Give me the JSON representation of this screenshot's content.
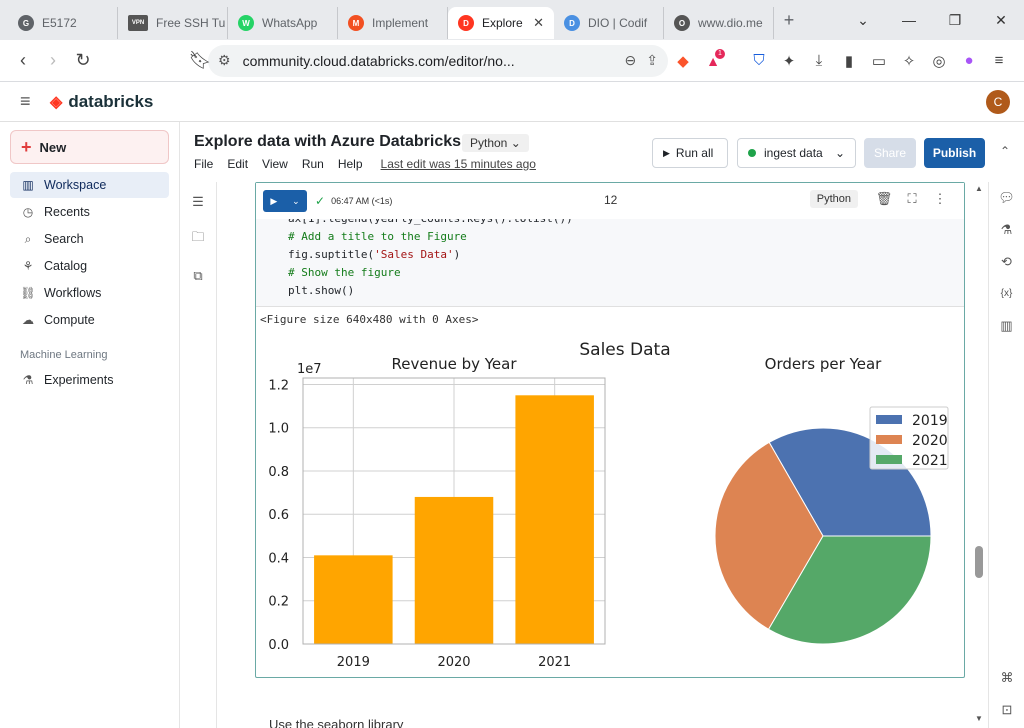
{
  "browser": {
    "tabs": [
      {
        "label": "E5172",
        "color": "#5f6368",
        "glyph": "G"
      },
      {
        "label": "Free SSH Tu",
        "color": "#555555",
        "glyph": "VPN"
      },
      {
        "label": "WhatsApp",
        "color": "#25d366",
        "glyph": "W"
      },
      {
        "label": "Implement",
        "color": "#f25022",
        "glyph": "M"
      },
      {
        "label": "Explore",
        "color": "#ff3621",
        "glyph": "D"
      },
      {
        "label": "DIO | Codif",
        "color": "#4a90e2",
        "glyph": "D"
      },
      {
        "label": "www.dio.me",
        "color": "#555555",
        "glyph": "O"
      }
    ],
    "url": "community.cloud.databricks.com/editor/no...",
    "badge": "1"
  },
  "app": {
    "brand": "databricks",
    "avatar": "C"
  },
  "sidebar": {
    "new_label": "New",
    "items": [
      {
        "label": "Workspace",
        "icon": "workspace-icon"
      },
      {
        "label": "Recents",
        "icon": "clock-icon"
      },
      {
        "label": "Search",
        "icon": "search-icon"
      },
      {
        "label": "Catalog",
        "icon": "catalog-icon"
      },
      {
        "label": "Workflows",
        "icon": "workflows-icon"
      },
      {
        "label": "Compute",
        "icon": "cloud-icon"
      }
    ],
    "section": "Machine Learning",
    "ml_items": [
      {
        "label": "Experiments",
        "icon": "flask-icon"
      }
    ]
  },
  "notebook": {
    "title": "Explore data with Azure Databricks",
    "language": "Python",
    "menu": [
      "File",
      "Edit",
      "View",
      "Run",
      "Help"
    ],
    "last_edit": "Last edit was 15 minutes ago",
    "run_all": "Run all",
    "cluster": "ingest data",
    "share": "Share",
    "publish": "Publish"
  },
  "cell": {
    "status_time": "06:47 AM (<1s)",
    "number": "12",
    "language": "Python",
    "code_cut": "ax[1].legend(yearly_counts.keys().tolist())",
    "code": [
      {
        "text": "# Add a title to the Figure",
        "type": "comment"
      },
      {
        "text": "fig.suptitle(",
        "str": "'Sales Data'",
        "end": ")",
        "type": "call"
      },
      {
        "text": "# Show the figure",
        "type": "comment"
      },
      {
        "text": "plt.show()",
        "type": "plain"
      }
    ],
    "output_text": "<Figure size 640x480 with 0 Axes>"
  },
  "chart_data": [
    {
      "type": "bar",
      "title": "Revenue by Year",
      "suptitle": "Sales Data",
      "categories": [
        "2019",
        "2020",
        "2021"
      ],
      "values": [
        0.41,
        0.68,
        1.15
      ],
      "scale_label": "1e7",
      "ylim": [
        0,
        1.23
      ],
      "yticks": [
        "0.0",
        "0.2",
        "0.4",
        "0.6",
        "0.8",
        "1.0",
        "1.2"
      ],
      "color": "#ffa500",
      "grid": true
    },
    {
      "type": "pie",
      "title": "Orders per Year",
      "labels": [
        "2019",
        "2020",
        "2021"
      ],
      "values": [
        33.3,
        33.3,
        33.4
      ],
      "colors": [
        "#4c72b0",
        "#dd8452",
        "#55a868"
      ],
      "legend": "top-right"
    }
  ],
  "markdown_next": "Use the seaborn library"
}
